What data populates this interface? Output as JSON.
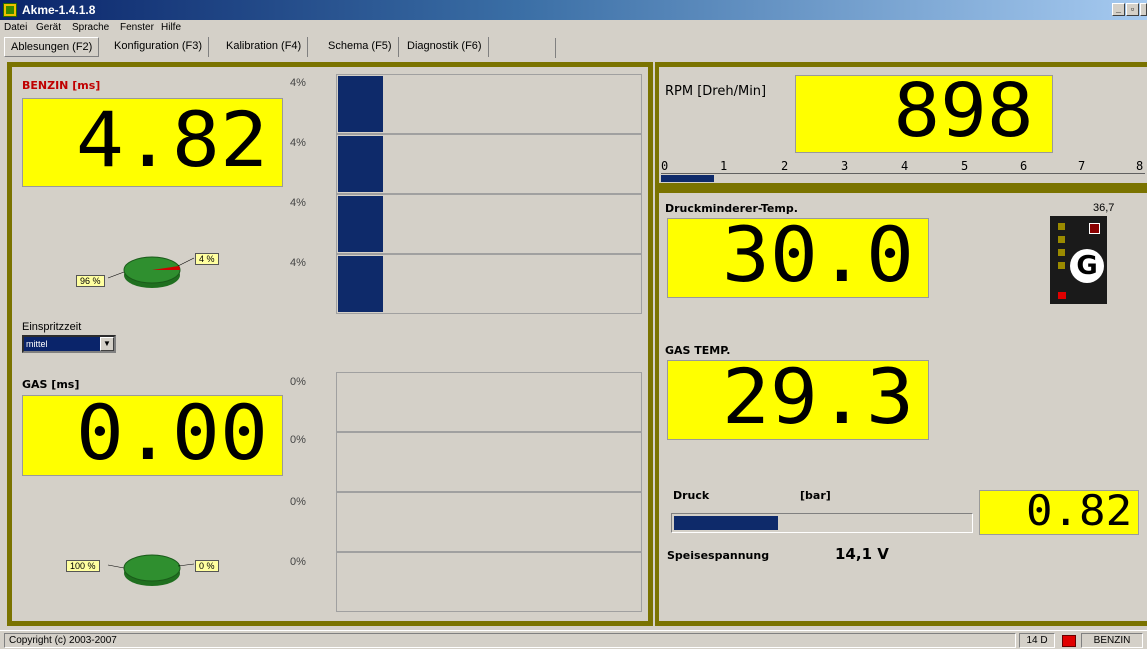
{
  "window": {
    "title": "Akme-1.4.1.8"
  },
  "menu": {
    "items": [
      "Datei",
      "Gerät",
      "Sprache",
      "Fenster",
      "Hilfe"
    ]
  },
  "tabs": [
    "Ablesungen (F2)",
    "Konfiguration (F3)",
    "Kalibration (F4)",
    "Schema (F5)",
    "Diagnostik (F6)"
  ],
  "benzin": {
    "label": "BENZIN [ms]",
    "value": "4.82",
    "bars": [
      {
        "pct": "4%",
        "fill": 0.15
      },
      {
        "pct": "4%",
        "fill": 0.15
      },
      {
        "pct": "4%",
        "fill": 0.15
      },
      {
        "pct": "4%",
        "fill": 0.15
      }
    ],
    "pie": {
      "left": "96 %",
      "right": "4 %",
      "share": 0.04
    }
  },
  "einspritzzeit": {
    "label": "Einspritzzeit",
    "selected": "mittel"
  },
  "gas": {
    "label": "GAS [ms]",
    "value": "0.00",
    "bars": [
      {
        "pct": "0%",
        "fill": 0
      },
      {
        "pct": "0%",
        "fill": 0
      },
      {
        "pct": "0%",
        "fill": 0
      },
      {
        "pct": "0%",
        "fill": 0
      }
    ],
    "pie": {
      "left": "100 %",
      "right": "0 %",
      "share": 0
    }
  },
  "rpm": {
    "label": "RPM [Dreh/Min]",
    "value": "898",
    "scale": [
      "0",
      "1",
      "2",
      "3",
      "4",
      "5",
      "6",
      "7",
      "8"
    ],
    "fill": 0.11
  },
  "druckminderer": {
    "label": "Druckminderer-Temp.",
    "value": "30.0",
    "max": "36,7"
  },
  "gastemp": {
    "label": "GAS TEMP.",
    "value": "29.3"
  },
  "druck": {
    "label": "Druck",
    "unit": "[bar]",
    "value": "0.82",
    "fill": 0.35
  },
  "speisespannung": {
    "label": "Speisespannung",
    "value": "14,1 V"
  },
  "indicator": {
    "letter": "G"
  },
  "status": {
    "copyright": "Copyright (c) 2003-2007",
    "code": "14 D",
    "mode": "BENZIN"
  },
  "colors": {
    "lcd": "#ffff00",
    "bar": "#0e2a6a",
    "frame": "#7a7300",
    "pie": "#2f8f2f",
    "status_led": "#e00000"
  }
}
